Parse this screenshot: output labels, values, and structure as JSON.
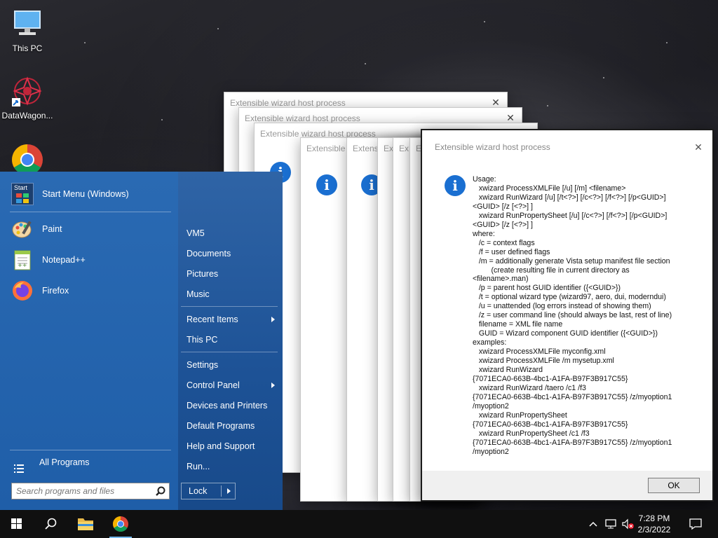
{
  "desktop": {
    "icons": [
      {
        "label": "This PC"
      },
      {
        "label": "DataWagon..."
      },
      {
        "label": "Google Chrome"
      }
    ]
  },
  "dialogs": {
    "title": "Extensible wizard host process",
    "stub_titles": [
      "Extensible wizard host process",
      "Extensible wizard host process",
      "Extensible wizard host process",
      "Extensible",
      "Extens",
      "Ex",
      "Ex",
      "Ex"
    ]
  },
  "front_dialog": {
    "title": "Extensible wizard host process",
    "message": "Usage:\n   xwizard ProcessXMLFile [/u] [/m] <filename>\n   xwizard RunWizard [/u] [/t<?>] [/c<?>] [/f<?>] [/p<GUID>]\n<GUID> [/z [<?>] ]\n   xwizard RunPropertySheet [/u] [/c<?>] [/f<?>] [/p<GUID>]\n<GUID> [/z [<?>] ]\nwhere:\n   /c = context flags\n   /f = user defined flags\n   /m = additionally generate Vista setup manifest file section\n         (create resulting file in current directory as\n<filename>.man)\n   /p = parent host GUID identifier ({<GUID>})\n   /t = optional wizard type (wizard97, aero, dui, moderndui)\n   /u = unattended (log errors instead of showing them)\n   /z = user command line (should always be last, rest of line)\n   filename = XML file name\n   GUID = Wizard component GUID identifier ({<GUID>})\nexamples:\n   xwizard ProcessXMLFile myconfig.xml\n   xwizard ProcessXMLFile /m mysetup.xml\n   xwizard RunWizard\n{7071ECA0-663B-4bc1-A1FA-B97F3B917C55}\n   xwizard RunWizard /taero /c1 /f3\n{7071ECA0-663B-4bc1-A1FA-B97F3B917C55} /z/myoption1\n/myoption2\n   xwizard RunPropertySheet\n{7071ECA0-663B-4bc1-A1FA-B97F3B917C55}\n   xwizard RunPropertySheet /c1 /f3\n{7071ECA0-663B-4bc1-A1FA-B97F3B917C55} /z/myoption1\n/myoption2",
    "ok_label": "OK",
    "close_glyph": "✕"
  },
  "start_menu": {
    "header_item": "Start Menu (Windows)",
    "header_icon_text": "Start",
    "pinned": [
      "Paint",
      "Notepad++",
      "Firefox"
    ],
    "all_programs": "All Programs",
    "right_items": [
      "VM5",
      "Documents",
      "Pictures",
      "Music",
      "Recent Items",
      "This PC",
      "Settings",
      "Control Panel",
      "Devices and Printers",
      "Default Programs",
      "Help and Support",
      "Run..."
    ],
    "search_placeholder": "Search programs and files",
    "lock_label": "Lock"
  },
  "taskbar": {
    "time": "7:28 PM",
    "date": "2/3/2022"
  },
  "colors": {
    "start_menu": "#1f5ea8",
    "info_icon": "#1a6fd1",
    "taskbar": "#101010"
  }
}
